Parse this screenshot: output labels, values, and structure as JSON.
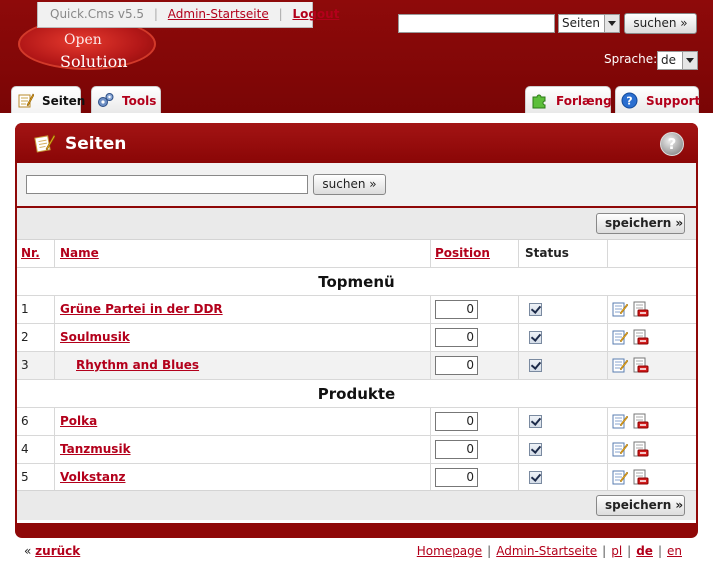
{
  "brand": {
    "logo_line1": "Open",
    "logo_line2": "Solution"
  },
  "top_bar": {
    "version": "Quick.Cms v5.5",
    "admin_home_link": "Admin-Startseite",
    "logout_link": "Logout"
  },
  "top_search": {
    "input_value": "",
    "scope_select": "Seiten",
    "button": "suchen »"
  },
  "language": {
    "label": "Sprache:",
    "selected": "de"
  },
  "tabs": [
    {
      "label": "Seiten",
      "icon": "pages-icon",
      "active": true
    },
    {
      "label": "Tools",
      "icon": "gears-icon",
      "active": false
    },
    {
      "label": "Forlæng",
      "icon": "puzzle-icon",
      "active": false
    },
    {
      "label": "Support",
      "icon": "help-icon",
      "active": false
    }
  ],
  "panel": {
    "title": "Seiten",
    "help": "?",
    "search_value": "",
    "search_button": "suchen »",
    "save_button": "speichern »"
  },
  "table": {
    "headers": {
      "nr": "Nr.",
      "name": "Name",
      "position": "Position",
      "status": "Status"
    },
    "groups": [
      {
        "title": "Topmenü",
        "rows": [
          {
            "nr": "1",
            "name": "Grüne Partei in der DDR",
            "position": "0",
            "status": true,
            "sub": false
          },
          {
            "nr": "2",
            "name": "Soulmusik",
            "position": "0",
            "status": true,
            "sub": false
          },
          {
            "nr": "3",
            "name": "Rhythm and Blues",
            "position": "0",
            "status": true,
            "sub": true
          }
        ]
      },
      {
        "title": "Produkte",
        "rows": [
          {
            "nr": "6",
            "name": "Polka",
            "position": "0",
            "status": true,
            "sub": false
          },
          {
            "nr": "4",
            "name": "Tanzmusik",
            "position": "0",
            "status": true,
            "sub": false
          },
          {
            "nr": "5",
            "name": "Volkstanz",
            "position": "0",
            "status": true,
            "sub": false
          }
        ]
      }
    ]
  },
  "footer": {
    "back_arrow": "«",
    "back": "zurück",
    "links": [
      "Homepage",
      "Admin-Startseite",
      "pl",
      "de",
      "en"
    ]
  },
  "colors": {
    "brand_red": "#8e0a0a",
    "link_red": "#b3001b"
  }
}
